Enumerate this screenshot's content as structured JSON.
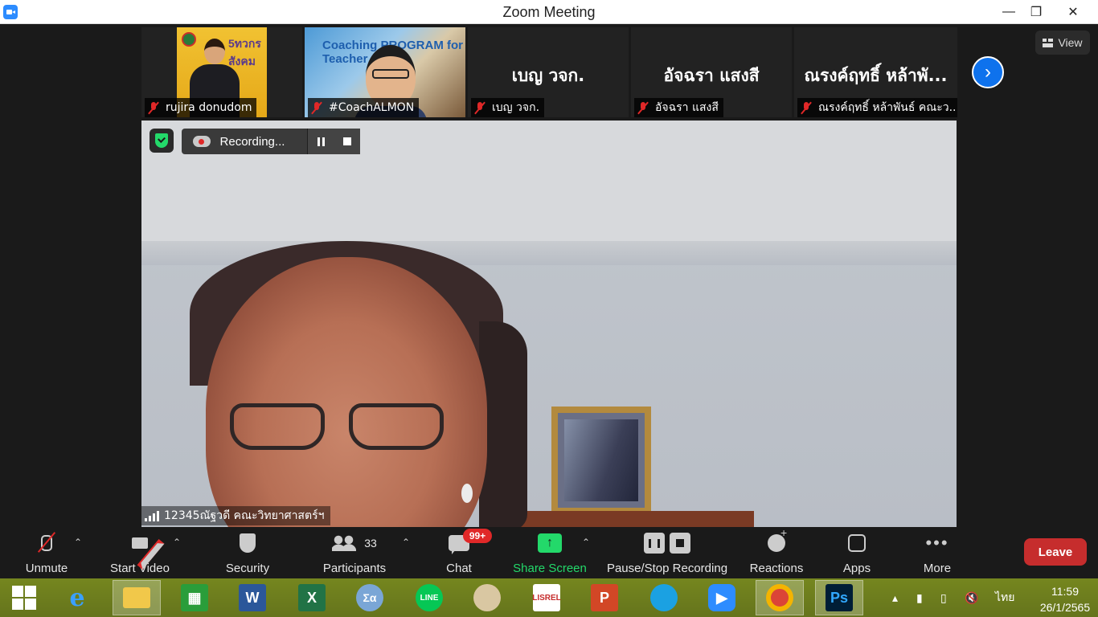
{
  "window": {
    "title": "Zoom Meeting"
  },
  "view_button": {
    "label": "View"
  },
  "thumbnails": [
    {
      "name": "rujira donudom",
      "has_video": true,
      "photo_text": "5ทวกร สังคม"
    },
    {
      "name": "#CoachALMON",
      "has_video": true,
      "photo_text": "Coaching PROGRAM for Teacher"
    },
    {
      "name": "เบญ วจก.",
      "big_name": "เบญ วจก.",
      "has_video": false
    },
    {
      "name": "อัจฉรา แสงสี",
      "big_name": "อัจฉรา แสงสี",
      "has_video": false
    },
    {
      "name": "ณรงค์ฤทธิ์ หล้าพันธ์ คณะว...",
      "big_name": "ณรงค์ฤทธิ์ หล้าพั...",
      "has_video": false
    }
  ],
  "recording": {
    "label": "Recording..."
  },
  "active_speaker": {
    "name": "12345ณัฐวดี คณะวิทยาศาสตร์ฯ"
  },
  "toolbar": {
    "unmute": "Unmute",
    "start_video": "Start Video",
    "security": "Security",
    "participants": "Participants",
    "participants_count": "33",
    "chat": "Chat",
    "chat_badge": "99+",
    "share_screen": "Share Screen",
    "pause_stop_recording": "Pause/Stop Recording",
    "reactions": "Reactions",
    "apps": "Apps",
    "more": "More",
    "leave": "Leave"
  },
  "taskbar": {
    "apps": [
      "windows-start",
      "internet-explorer",
      "file-explorer",
      "store",
      "word",
      "excel",
      "math-input",
      "line",
      "paint",
      "lisrel",
      "powerpoint",
      "edge",
      "zoom",
      "chrome",
      "photoshop"
    ],
    "language": "ไทย",
    "time": "11:59",
    "date": "26/1/2565"
  },
  "colors": {
    "accent": "#2d8cff",
    "leave": "#c62d2d",
    "share": "#23d96a",
    "muted": "#e02828"
  }
}
